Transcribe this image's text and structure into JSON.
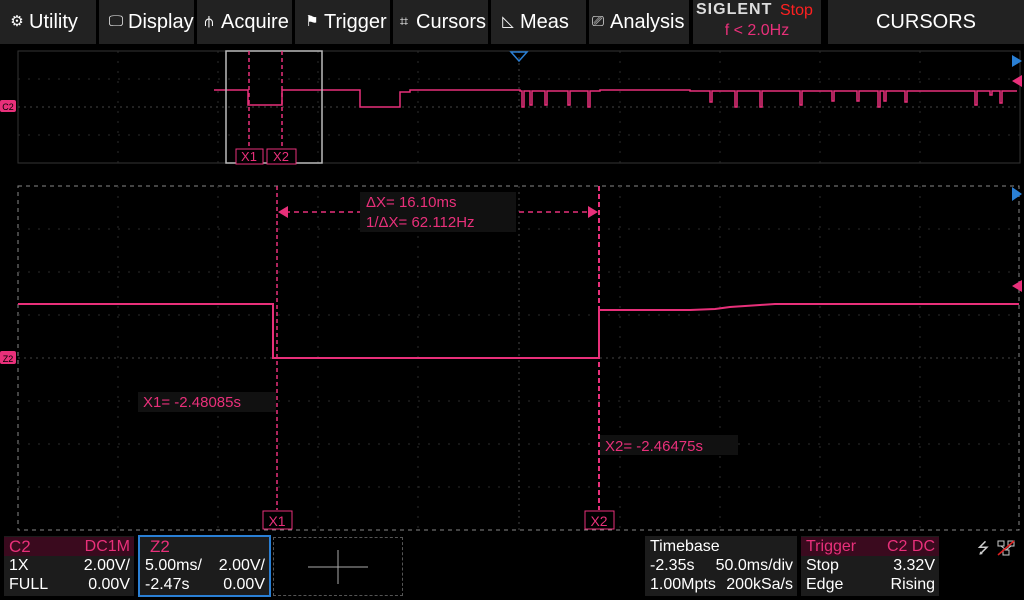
{
  "menu": {
    "utility": "Utility",
    "display": "Display",
    "acquire": "Acquire",
    "trigger": "Trigger",
    "cursors": "Cursors",
    "meas": "Meas",
    "analysis": "Analysis"
  },
  "brand": {
    "name": "SIGLENT",
    "run_state": "Stop",
    "trigger_freq": "f < 2.0Hz"
  },
  "mode_title": "CURSORS",
  "markers": {
    "c2": "C2",
    "z2": "Z2",
    "x1": "X1",
    "x2": "X2"
  },
  "cursor_readouts": {
    "delta_x": "ΔX= 16.10ms",
    "inv_delta_x": "1/ΔX= 62.112Hz",
    "x1": "X1= -2.48085s",
    "x2": "X2= -2.46475s"
  },
  "channel_c2": {
    "name": "C2",
    "coupling": "DC1M",
    "probe": "1X",
    "scale": "2.00V/",
    "bandwidth": "FULL",
    "offset": "0.00V"
  },
  "zoom_z2": {
    "name": "Z2",
    "timebase": "5.00ms/",
    "scale": "2.00V/",
    "delay": "-2.47s",
    "offset": "0.00V"
  },
  "timebase": {
    "title": "Timebase",
    "delay": "-2.35s",
    "scale": "50.0ms/div",
    "memory": "1.00Mpts",
    "sample_rate": "200kSa/s"
  },
  "trigger": {
    "title": "Trigger",
    "source": "C2 DC",
    "state": "Stop",
    "level": "3.32V",
    "type": "Edge",
    "slope": "Rising"
  },
  "colors": {
    "trace": "#e8307a",
    "cursor": "#e8307a",
    "zoom_border": "#2a7fd4",
    "trigger_marker": "#2a7fd4",
    "menu_bg": "#222222"
  },
  "icons": {
    "utility": "gear-icon",
    "display": "display-icon",
    "acquire": "acquire-icon",
    "trigger": "flag-icon",
    "cursors": "cursor-grid-icon",
    "meas": "meas-icon",
    "analysis": "analysis-icon",
    "usb": "usb-icon",
    "network": "network-icon"
  }
}
